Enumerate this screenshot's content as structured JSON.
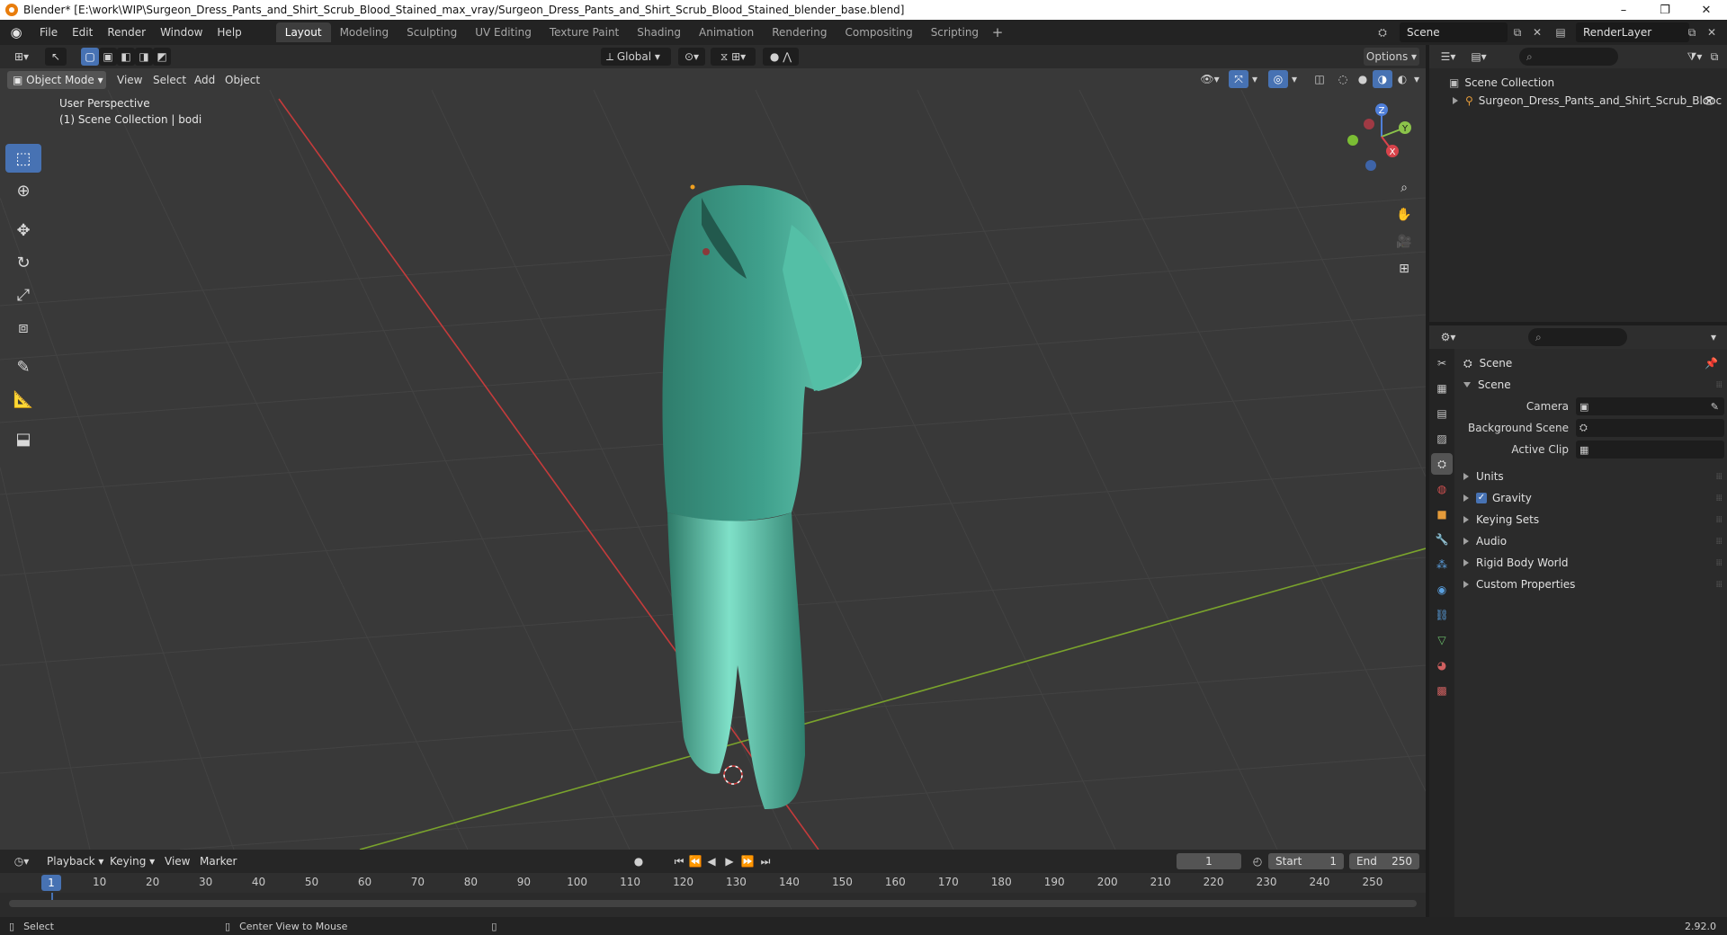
{
  "window": {
    "title": "Blender* [E:\\work\\WIP\\Surgeon_Dress_Pants_and_Shirt_Scrub_Blood_Stained_max_vray/Surgeon_Dress_Pants_and_Shirt_Scrub_Blood_Stained_blender_base.blend]",
    "minimize": "–",
    "maximize": "❐",
    "close": "✕"
  },
  "menu": {
    "items": [
      "File",
      "Edit",
      "Render",
      "Window",
      "Help"
    ]
  },
  "workspaces": {
    "tabs": [
      "Layout",
      "Modeling",
      "Sculpting",
      "UV Editing",
      "Texture Paint",
      "Shading",
      "Animation",
      "Rendering",
      "Compositing",
      "Scripting"
    ],
    "active": "Layout",
    "add": "+"
  },
  "scene_selector": {
    "value": "Scene"
  },
  "view_layer_selector": {
    "value": "RenderLayer"
  },
  "viewport": {
    "mode": "Object Mode",
    "menus": [
      "View",
      "Select",
      "Add",
      "Object"
    ],
    "transform_orientation": "Global",
    "options_label": "Options",
    "perspective_label": "User Perspective",
    "collection_label": "(1) Scene Collection | bodi",
    "gizmo_axes": {
      "x": "X",
      "y": "Y",
      "z": "Z"
    }
  },
  "outliner": {
    "root": "Scene Collection",
    "items": [
      {
        "label": "Surgeon_Dress_Pants_and_Shirt_Scrub_Blooc"
      }
    ]
  },
  "properties": {
    "context": "Scene",
    "panel_title": "Scene",
    "fields": [
      {
        "label": "Camera",
        "value": ""
      },
      {
        "label": "Background Scene",
        "value": ""
      },
      {
        "label": "Active Clip",
        "value": ""
      }
    ],
    "sections": [
      {
        "label": "Units"
      },
      {
        "label": "Gravity",
        "checked": true
      },
      {
        "label": "Keying Sets"
      },
      {
        "label": "Audio"
      },
      {
        "label": "Rigid Body World"
      },
      {
        "label": "Custom Properties"
      }
    ]
  },
  "timeline": {
    "menus": [
      "Playback",
      "Keying",
      "View",
      "Marker"
    ],
    "current_frame": "1",
    "start_label": "Start",
    "start_value": "1",
    "end_label": "End",
    "end_value": "250",
    "ticks": [
      "1",
      "10",
      "20",
      "30",
      "40",
      "50",
      "60",
      "70",
      "80",
      "90",
      "100",
      "110",
      "120",
      "130",
      "140",
      "150",
      "160",
      "170",
      "180",
      "190",
      "200",
      "210",
      "220",
      "230",
      "240",
      "250"
    ]
  },
  "statusbar": {
    "select": "Select",
    "center_view": "Center View to Mouse",
    "version": "2.92.0"
  },
  "colors": {
    "accent": "#4772b3",
    "viewport_bg": "#393939",
    "x_axis": "#c43b3b",
    "y_axis": "#7aa32c",
    "garment": "#3fa08c"
  }
}
